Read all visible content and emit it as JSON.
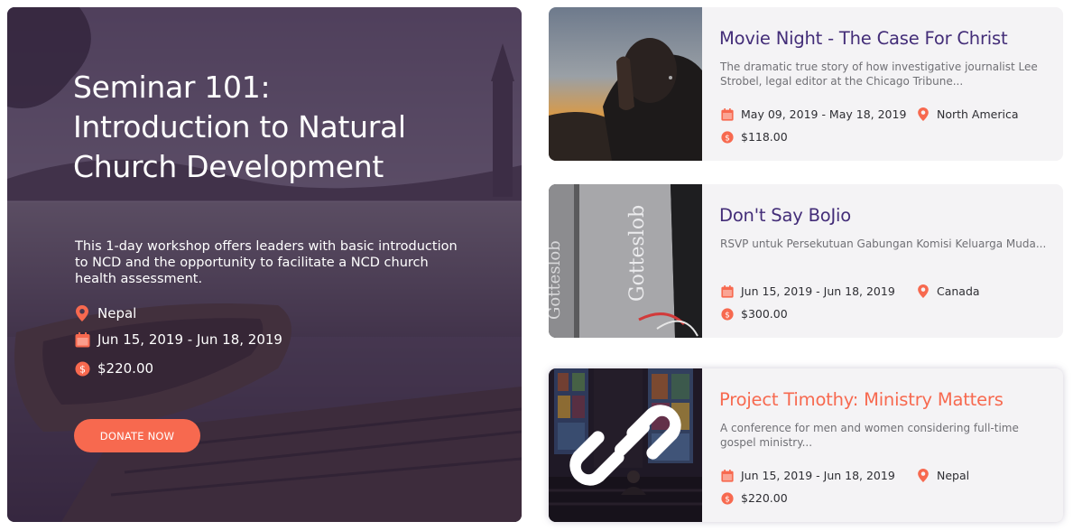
{
  "featured": {
    "title_lines": [
      "Seminar 101:",
      "Introduction to Natural",
      "Church Development"
    ],
    "description": "This 1-day workshop offers leaders with basic introduction to NCD and the opportunity to facilitate a NCD church health assessment.",
    "location": "Nepal",
    "dates": "Jun 15, 2019 - Jun 18, 2019",
    "price": "$220.00",
    "donate_label": "DONATE NOW",
    "icons": {
      "location": "map-pin-icon",
      "date": "calendar-icon",
      "price": "dollar-coin-icon"
    }
  },
  "events": [
    {
      "title": "Movie Night - The Case For Christ",
      "description": "The dramatic true story of how investigative journalist Lee Strobel, legal editor at the Chicago Tribune...",
      "dates": "May 09, 2019 - May 18, 2019",
      "location": "North America",
      "price": "$118.00",
      "image": "praying-man-photo"
    },
    {
      "title": "Don't Say BoJio",
      "description": "RSVP untuk Persekutuan Gabungan Komisi Keluarga Muda...",
      "dates": "Jun 15, 2019 - Jun 18, 2019",
      "location": "Canada",
      "price": "$300.00",
      "image": "gotteslob-books-photo",
      "image_text": [
        "Gotteslob",
        "Gotteslob"
      ]
    },
    {
      "title": "Project Timothy: Ministry Matters",
      "description": "A conference for men and women considering full-time gospel ministry...",
      "dates": "Jun 15, 2019 - Jun 18, 2019",
      "location": "Nepal",
      "price": "$220.00",
      "image": "stained-glass-church-photo",
      "hover_icon": "link-icon"
    }
  ],
  "colors": {
    "accent": "#f7694f",
    "title_purple": "#432d78",
    "card_bg": "#f4f3f5",
    "overlay": "#342442"
  }
}
